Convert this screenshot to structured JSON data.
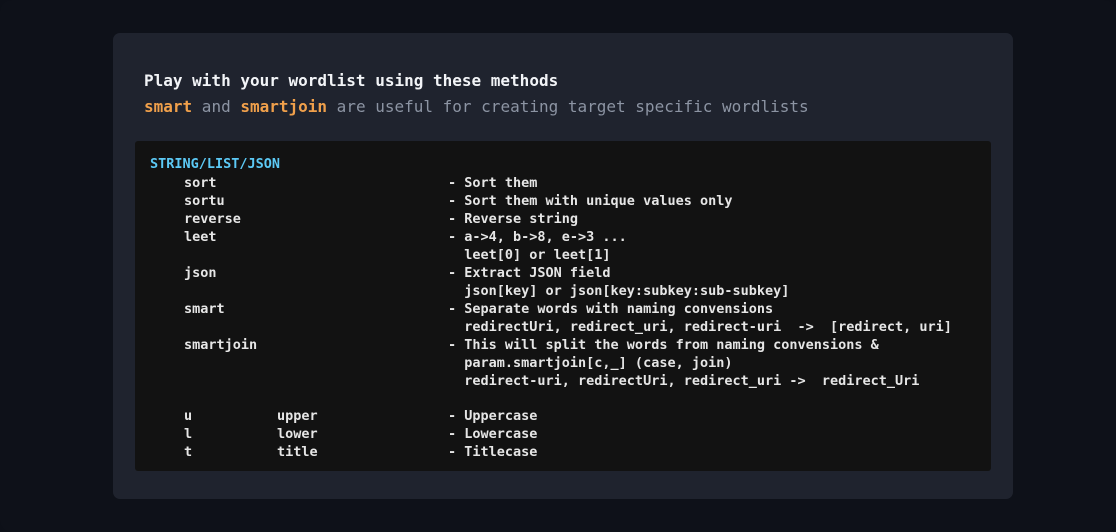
{
  "header": {
    "title": "Play with your wordlist using these methods",
    "subtitle_hl1": "smart",
    "subtitle_mid": " and ",
    "subtitle_hl2": "smartjoin",
    "subtitle_rest": " are useful for creating target specific wordlists"
  },
  "terminal": {
    "section": "STRING/LIST/JSON",
    "lines": [
      {
        "cmd": "sort",
        "alias": "",
        "desc": "- Sort them"
      },
      {
        "cmd": "sortu",
        "alias": "",
        "desc": "- Sort them with unique values only"
      },
      {
        "cmd": "reverse",
        "alias": "",
        "desc": "- Reverse string"
      },
      {
        "cmd": "leet",
        "alias": "",
        "desc": "- a->4, b->8, e->3 ..."
      },
      {
        "cmd": "",
        "alias": "",
        "desc": "  leet[0] or leet[1]"
      },
      {
        "cmd": "json",
        "alias": "",
        "desc": "- Extract JSON field"
      },
      {
        "cmd": "",
        "alias": "",
        "desc": "  json[key] or json[key:subkey:sub-subkey]"
      },
      {
        "cmd": "smart",
        "alias": "",
        "desc": "- Separate words with naming convensions"
      },
      {
        "cmd": "",
        "alias": "",
        "desc": "  redirectUri, redirect_uri, redirect-uri  ->  [redirect, uri]"
      },
      {
        "cmd": "smartjoin",
        "alias": "",
        "desc": "- This will split the words from naming convensions &"
      },
      {
        "cmd": "",
        "alias": "",
        "desc": "  param.smartjoin[c,_] (case, join)"
      },
      {
        "cmd": "",
        "alias": "",
        "desc": "  redirect-uri, redirectUri, redirect_uri ->  redirect_Uri"
      },
      {
        "cmd": "",
        "alias": "",
        "desc": ""
      },
      {
        "cmd": "u",
        "alias": "upper",
        "desc": "- Uppercase"
      },
      {
        "cmd": "l",
        "alias": "lower",
        "desc": "- Lowercase"
      },
      {
        "cmd": "t",
        "alias": "title",
        "desc": "- Titlecase"
      }
    ]
  },
  "colors": {
    "background": "#0e1119",
    "card": "#1f232e",
    "terminal": "#121212",
    "highlight": "#f0a04b",
    "section": "#5cc9f5"
  }
}
